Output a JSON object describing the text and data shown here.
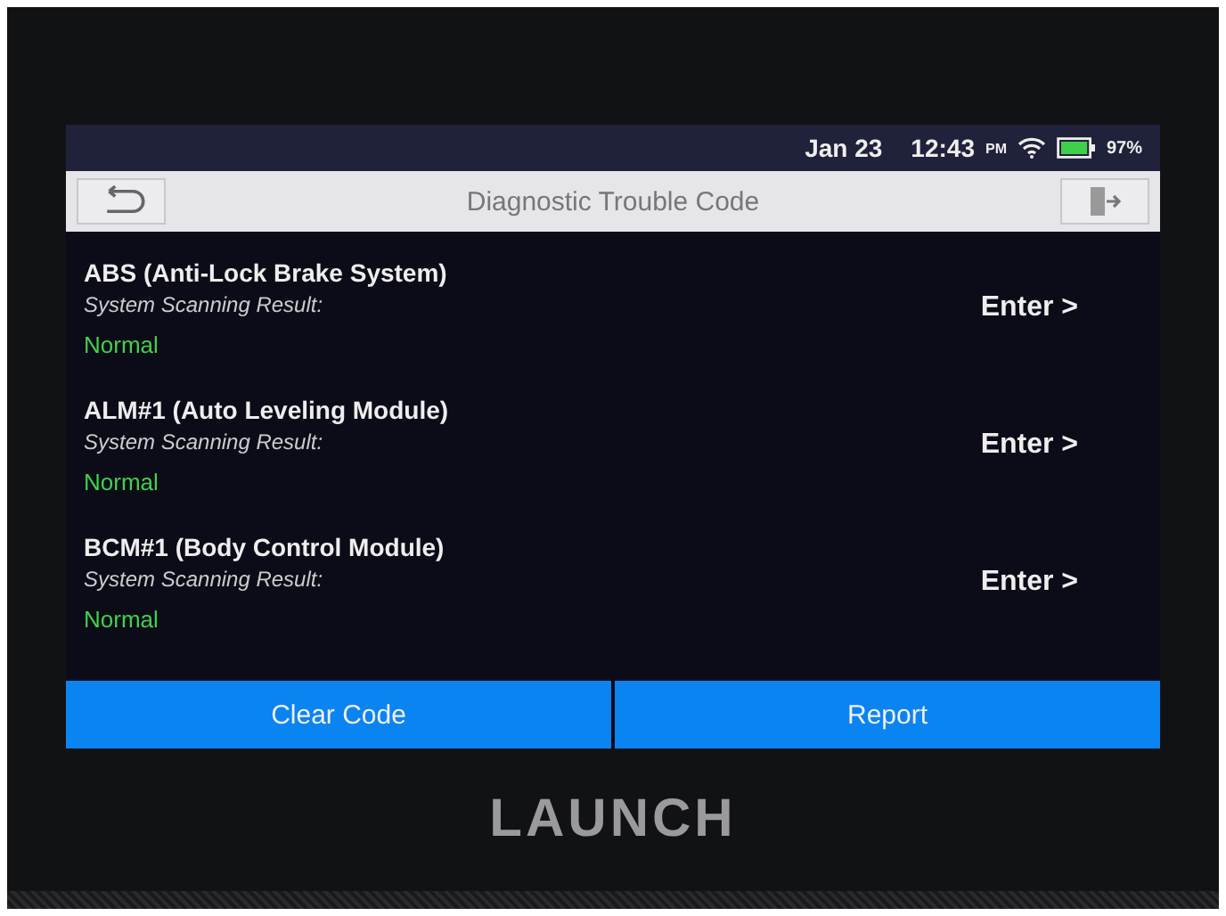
{
  "status_bar": {
    "date": "Jan 23",
    "time": "12:43",
    "ampm": "PM",
    "battery": "97%"
  },
  "title_bar": {
    "title": "Diagnostic Trouble Code"
  },
  "systems": [
    {
      "name": "ABS (Anti-Lock Brake System)",
      "result_label": "System Scanning Result:",
      "result": "Normal",
      "action": "Enter >"
    },
    {
      "name": "ALM#1 (Auto Leveling Module)",
      "result_label": "System Scanning Result:",
      "result": "Normal",
      "action": "Enter >"
    },
    {
      "name": "BCM#1 (Body Control Module)",
      "result_label": "System Scanning Result:",
      "result": "Normal",
      "action": "Enter >"
    }
  ],
  "buttons": [
    "Clear Code",
    "Report"
  ],
  "device": {
    "brand": "LAUNCH"
  }
}
